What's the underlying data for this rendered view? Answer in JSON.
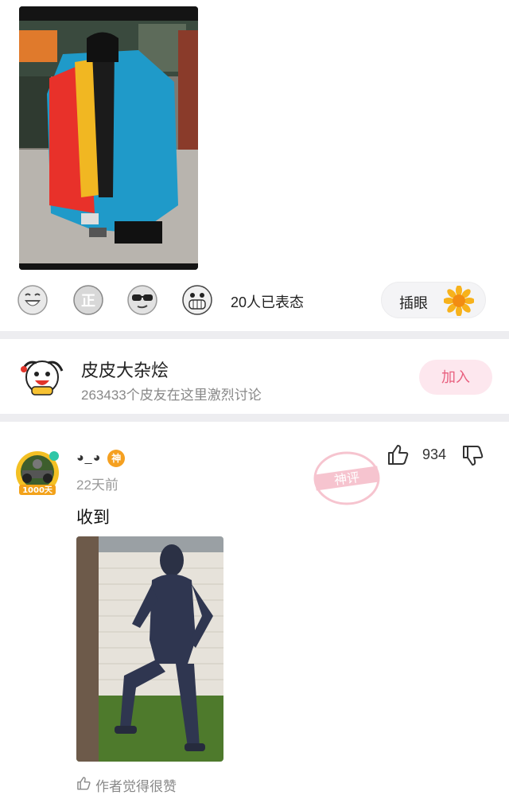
{
  "reactions": {
    "count_text": "20人已表态",
    "emojis": [
      "laugh-emoji-icon",
      "zheng-emoji-icon",
      "sunglasses-emoji-icon",
      "grin-emoji-icon"
    ],
    "insert_eye_label": "插眼",
    "insert_eye_icon": "sunflower-icon"
  },
  "topic": {
    "title": "皮皮大杂烩",
    "subtitle": "263433个皮友在这里激烈讨论",
    "join_label": "加入",
    "accent": "#e8607f"
  },
  "comment": {
    "username": "◕_◕",
    "badge": "神",
    "avatar_badge": "1000天",
    "time": "22天前",
    "text": "收到",
    "like_count": "934",
    "stamp_text": "神评",
    "author_liked": "作者觉得很赞"
  }
}
